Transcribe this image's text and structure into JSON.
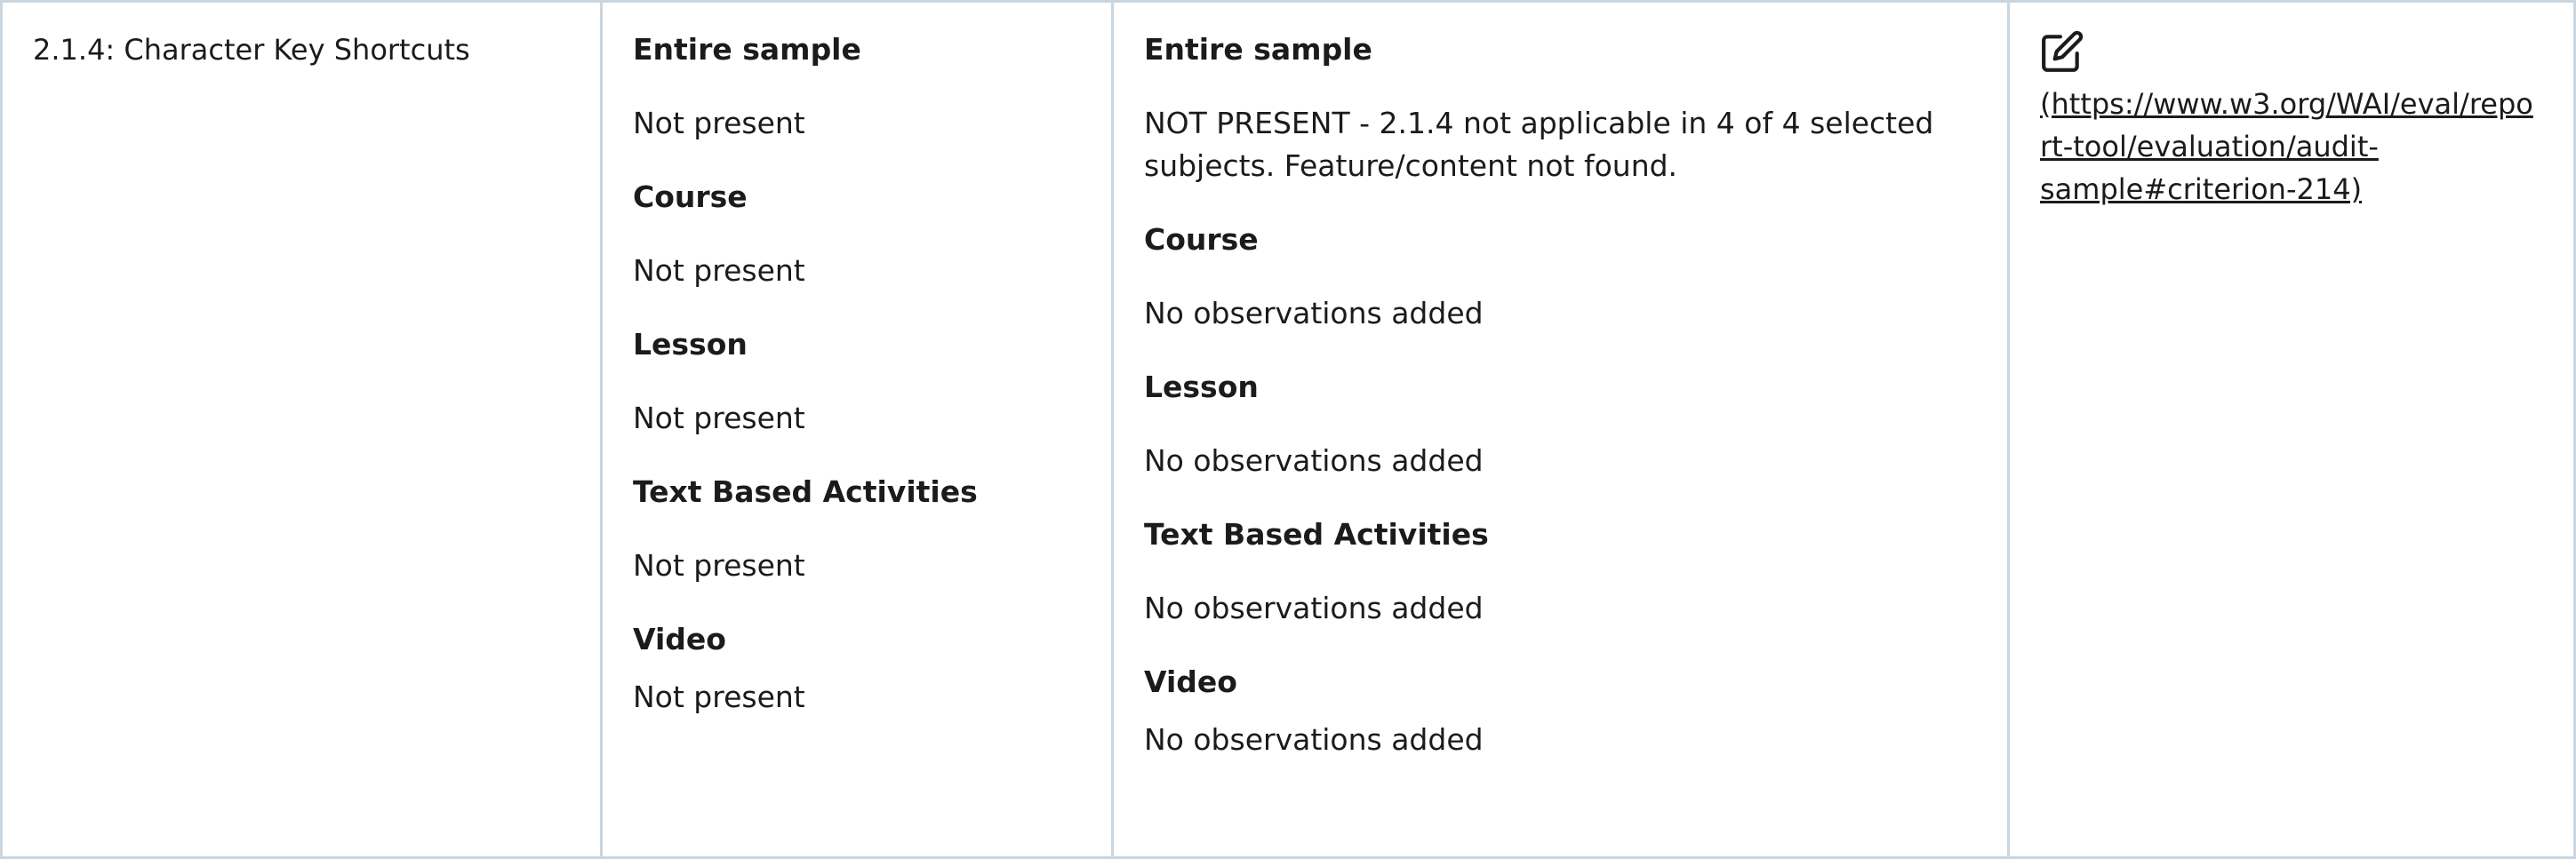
{
  "criterion": {
    "label": "2.1.4: Character Key Shortcuts"
  },
  "results": [
    {
      "title": "Entire sample",
      "value": "Not present"
    },
    {
      "title": "Course",
      "value": "Not present"
    },
    {
      "title": "Lesson",
      "value": "Not present"
    },
    {
      "title": "Text Based Activities",
      "value": "Not present"
    },
    {
      "title": "Video",
      "value": "Not present"
    }
  ],
  "observations": [
    {
      "title": "Entire sample",
      "value": "NOT PRESENT - 2.1.4 not applicable in 4 of 4 selected subjects. Feature/content not found."
    },
    {
      "title": "Course",
      "value": "No observations added"
    },
    {
      "title": "Lesson",
      "value": "No observations added"
    },
    {
      "title": "Text Based Activities",
      "value": "No observations added"
    },
    {
      "title": "Video",
      "value": "No observations added"
    }
  ],
  "edit": {
    "icon": "edit-icon",
    "link_text": "(https://www.w3.org/WAI/eval/report-tool/evaluation/audit-sample#criterion-214)"
  }
}
